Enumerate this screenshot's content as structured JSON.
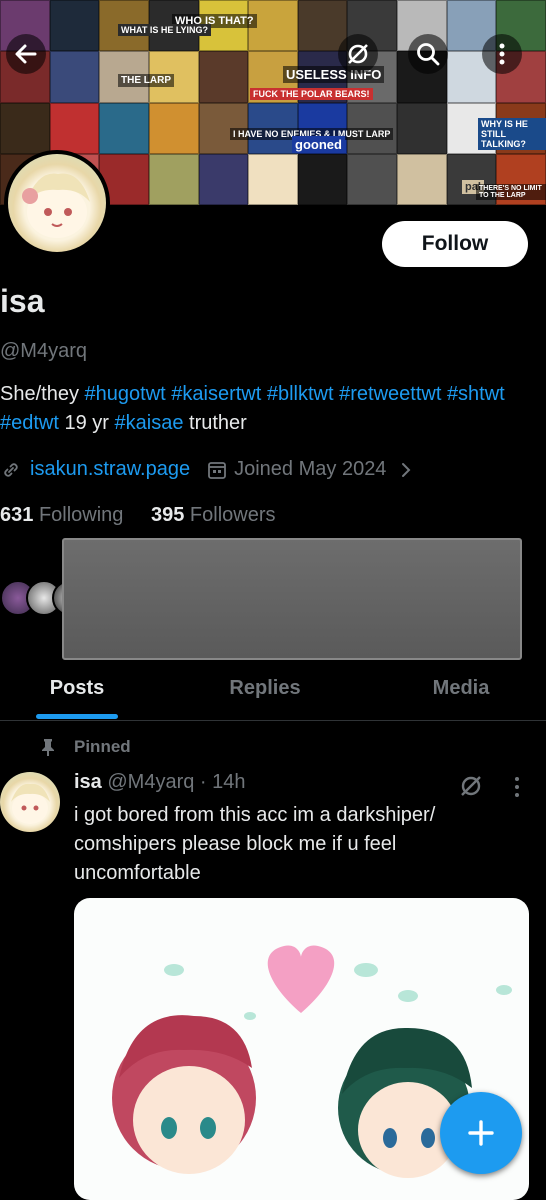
{
  "banner": {
    "captions": [
      "WHO IS THAT?",
      "USELESS INFO",
      "FUCK THE POLAR BEARS!",
      "I HAVE NO ENEMIES & I MUST LARP",
      "WHAT IS HE LYING?",
      "WHY IS HE STILL TALKING?",
      "gooned",
      "pal",
      "THE LARP",
      "THERE'S NO LIMIT TO THE LARP"
    ],
    "tile_colors": [
      "#6b3b6e",
      "#1e2a3a",
      "#8a6a2a",
      "#2b2b2b",
      "#d8c23a",
      "#c9a43c",
      "#4a3a2a",
      "#3a3a3a",
      "#b9b9b9",
      "#88a0b8",
      "#3c6a3c",
      "#7a2a2a",
      "#3a4a7a",
      "#b8a890",
      "#e0c060",
      "#5a3a2a",
      "#c8a040",
      "#2a2a4a",
      "#6a6a6a",
      "#1a1a1a",
      "#cfd8e0",
      "#a04040",
      "#3a2a1a",
      "#c03030",
      "#2a6a8a",
      "#d09030",
      "#7a5a3a",
      "#2a4a8a",
      "#1a3aa0",
      "#505050",
      "#303030",
      "#e8e8e8",
      "#8a3a1a",
      "#4a2a1a",
      "#c05050",
      "#9a2a2a",
      "#a0a060",
      "#3a3a6a",
      "#f0e0c0",
      "#1a1a1a",
      "#505050",
      "#d0c0a0",
      "#3a3a3a",
      "#b04020"
    ]
  },
  "follow_label": "Follow",
  "profile": {
    "name": "isa",
    "handle": "@M4yarq",
    "bio_parts": [
      {
        "t": "She/they ",
        "tag": false
      },
      {
        "t": "#hugotwt",
        "tag": true
      },
      {
        "t": " ",
        "tag": false
      },
      {
        "t": "#kaisertwt",
        "tag": true
      },
      {
        "t": " ",
        "tag": false
      },
      {
        "t": "#bllktwt",
        "tag": true
      },
      {
        "t": " ",
        "tag": false
      },
      {
        "t": "#retweettwt",
        "tag": true
      },
      {
        "t": " ",
        "tag": false
      },
      {
        "t": "#shtwt",
        "tag": true
      },
      {
        "t": " ",
        "tag": false
      },
      {
        "t": "#edtwt",
        "tag": true
      },
      {
        "t": " 19 yr ",
        "tag": false
      },
      {
        "t": "#kaisae",
        "tag": true
      },
      {
        "t": " truther",
        "tag": false
      }
    ],
    "link": "isakun.straw.page",
    "joined": "Joined May 2024",
    "following_count": "631",
    "following_label": "Following",
    "followers_count": "395",
    "followers_label": "Followers"
  },
  "tabs": [
    "Posts",
    "Replies",
    "Media"
  ],
  "post": {
    "pinned_label": "Pinned",
    "author": "isa",
    "handle_time": "@M4yarq · 14h",
    "text": "i got bored from this acc im a darkshiper/ comshipers please block me if u feel uncomfortable"
  },
  "colors": {
    "accent": "#1d9bf0",
    "muted": "#71767b",
    "text": "#e7e9ea"
  },
  "icons": [
    "back-arrow-icon",
    "no-notification-icon",
    "search-icon",
    "more-vertical-icon",
    "link-icon",
    "calendar-icon",
    "chevron-right-icon",
    "pin-icon",
    "grok-icon",
    "more-vertical-icon",
    "plus-icon"
  ]
}
